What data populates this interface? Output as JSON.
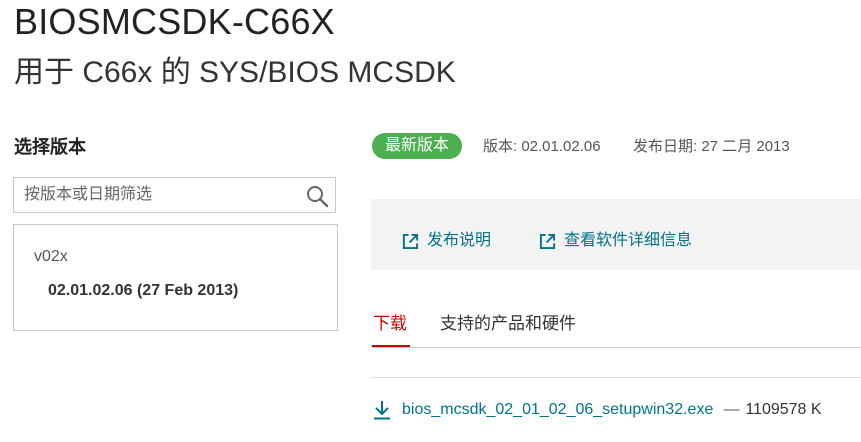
{
  "page": {
    "title": "BIOSMCSDK-C66X",
    "subtitle": "用于 C66x 的 SYS/BIOS MCSDK"
  },
  "version_selector": {
    "heading": "选择版本",
    "search_placeholder": "按版本或日期筛选",
    "group_label": "v02x",
    "items": [
      {
        "label": "02.01.02.06 (27 Feb 2013)"
      }
    ]
  },
  "release_info": {
    "badge": "最新版本",
    "version": "版本: 02.01.02.06",
    "date": "发布日期: 27 二月 2013"
  },
  "links": {
    "release_notes": "发布说明",
    "software_details": "查看软件详细信息"
  },
  "tabs": [
    {
      "label": "下载"
    },
    {
      "label": "支持的产品和硬件"
    }
  ],
  "downloads": [
    {
      "filename": "bios_mcsdk_02_01_02_06_setupwin32.exe",
      "separator": "—",
      "size": "1109578 K"
    }
  ],
  "colors": {
    "accent_red": "#cc0000",
    "link_teal": "#00738a",
    "badge_green": "#4caf50"
  }
}
